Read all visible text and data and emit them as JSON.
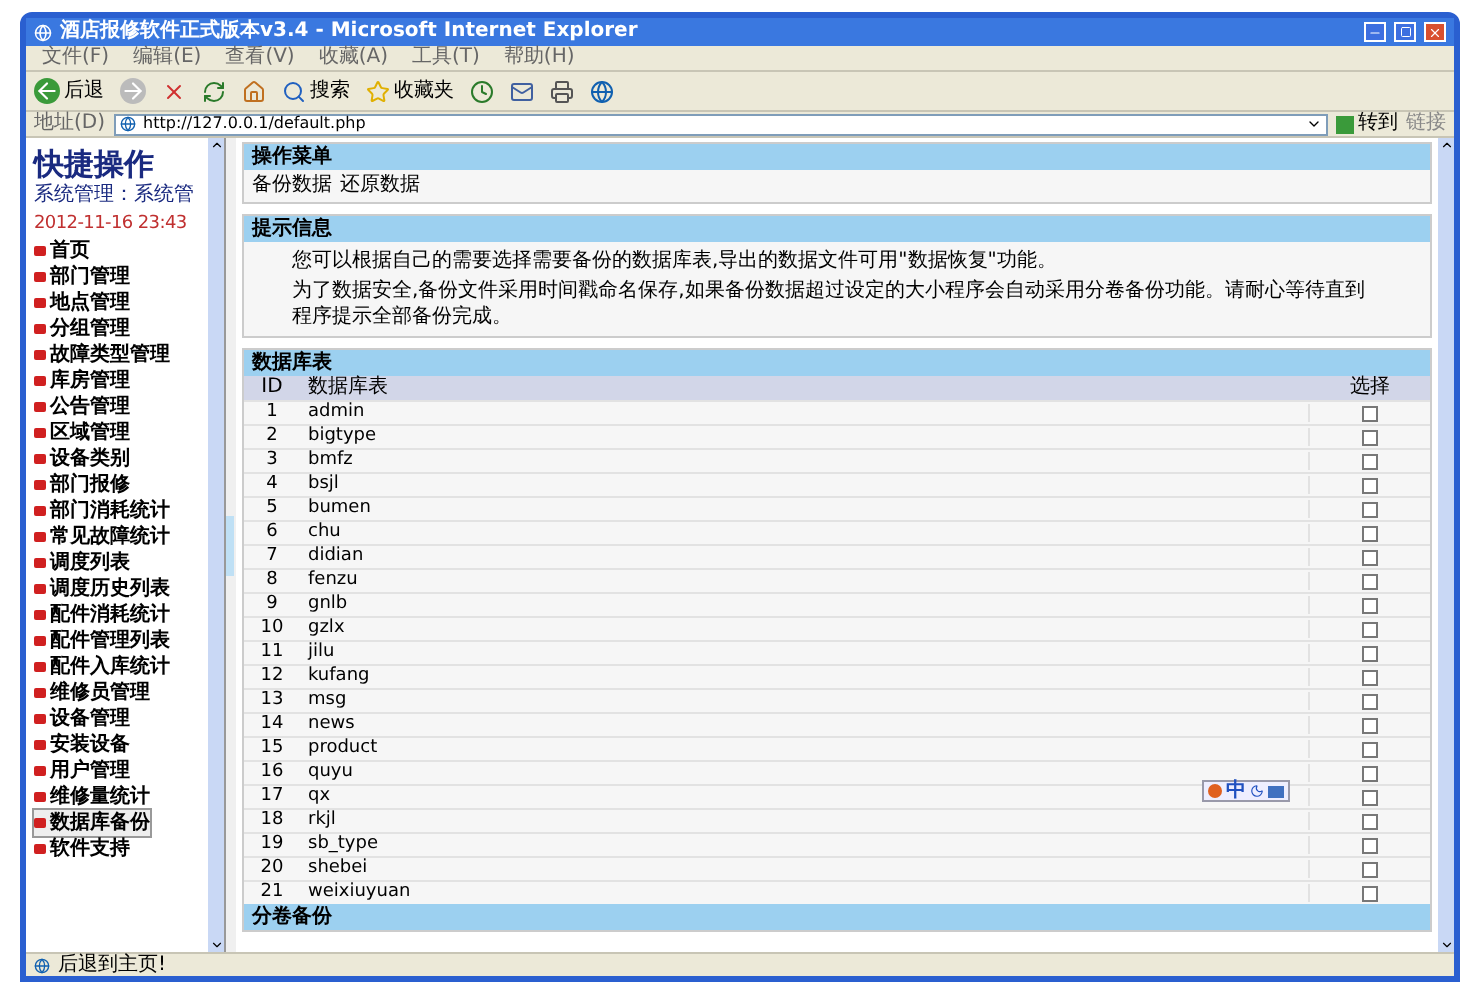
{
  "window": {
    "title": "酒店报修软件正式版本v3.4 - Microsoft Internet Explorer"
  },
  "menu_bar": [
    "文件(F)",
    "编辑(E)",
    "查看(V)",
    "收藏(A)",
    "工具(T)",
    "帮助(H)"
  ],
  "toolbar": {
    "back": "后退",
    "search": "搜索",
    "favorites": "收藏夹"
  },
  "address_bar": {
    "label": "地址(D)",
    "value": "http://127.0.0.1/default.php",
    "go": "转到",
    "links": "链接"
  },
  "sidebar": {
    "title": "快捷操作",
    "user": "系统管理：系统管",
    "date": "2012-11-16 23:43",
    "items": [
      {
        "label": "首页",
        "selected": false
      },
      {
        "label": "部门管理",
        "selected": false
      },
      {
        "label": "地点管理",
        "selected": false
      },
      {
        "label": "分组管理",
        "selected": false
      },
      {
        "label": "故障类型管理",
        "selected": false
      },
      {
        "label": "库房管理",
        "selected": false
      },
      {
        "label": "公告管理",
        "selected": false
      },
      {
        "label": "区域管理",
        "selected": false
      },
      {
        "label": "设备类别",
        "selected": false
      },
      {
        "label": "部门报修",
        "selected": false
      },
      {
        "label": "部门消耗统计",
        "selected": false
      },
      {
        "label": "常见故障统计",
        "selected": false
      },
      {
        "label": "调度列表",
        "selected": false
      },
      {
        "label": "调度历史列表",
        "selected": false
      },
      {
        "label": "配件消耗统计",
        "selected": false
      },
      {
        "label": "配件管理列表",
        "selected": false
      },
      {
        "label": "配件入库统计",
        "selected": false
      },
      {
        "label": "维修员管理",
        "selected": false
      },
      {
        "label": "设备管理",
        "selected": false
      },
      {
        "label": "安装设备",
        "selected": false
      },
      {
        "label": "用户管理",
        "selected": false
      },
      {
        "label": "维修量统计",
        "selected": false
      },
      {
        "label": "数据库备份",
        "selected": true
      },
      {
        "label": "软件支持",
        "selected": false
      }
    ]
  },
  "operation_menu": {
    "title": "操作菜单",
    "links": [
      "备份数据",
      "还原数据"
    ]
  },
  "tips": {
    "title": "提示信息",
    "paragraphs": [
      "您可以根据自己的需要选择需要备份的数据库表,导出的数据文件可用\"数据恢复\"功能。",
      "为了数据安全,备份文件采用时间戳命名保存,如果备份数据超过设定的大小程序会自动采用分卷备份功能。请耐心等待直到程序提示全部备份完成。"
    ]
  },
  "table": {
    "title": "数据库表",
    "columns": [
      "ID",
      "数据库表",
      "选择"
    ],
    "rows": [
      {
        "id": "1",
        "name": "admin",
        "checked": false
      },
      {
        "id": "2",
        "name": "bigtype",
        "checked": false
      },
      {
        "id": "3",
        "name": "bmfz",
        "checked": false
      },
      {
        "id": "4",
        "name": "bsjl",
        "checked": false
      },
      {
        "id": "5",
        "name": "bumen",
        "checked": false
      },
      {
        "id": "6",
        "name": "chu",
        "checked": false
      },
      {
        "id": "7",
        "name": "didian",
        "checked": false
      },
      {
        "id": "8",
        "name": "fenzu",
        "checked": false
      },
      {
        "id": "9",
        "name": "gnlb",
        "checked": false
      },
      {
        "id": "10",
        "name": "gzlx",
        "checked": false
      },
      {
        "id": "11",
        "name": "jilu",
        "checked": false
      },
      {
        "id": "12",
        "name": "kufang",
        "checked": false
      },
      {
        "id": "13",
        "name": "msg",
        "checked": false
      },
      {
        "id": "14",
        "name": "news",
        "checked": false
      },
      {
        "id": "15",
        "name": "product",
        "checked": false
      },
      {
        "id": "16",
        "name": "quyu",
        "checked": false
      },
      {
        "id": "17",
        "name": "qx",
        "checked": false
      },
      {
        "id": "18",
        "name": "rkjl",
        "checked": false
      },
      {
        "id": "19",
        "name": "sb_type",
        "checked": false
      },
      {
        "id": "20",
        "name": "shebei",
        "checked": false
      },
      {
        "id": "21",
        "name": "weixiuyuan",
        "checked": false
      }
    ]
  },
  "split_backup": {
    "title": "分卷备份"
  },
  "ime_bar": {
    "label": "中"
  },
  "status_bar": {
    "text": "后退到主页!"
  }
}
